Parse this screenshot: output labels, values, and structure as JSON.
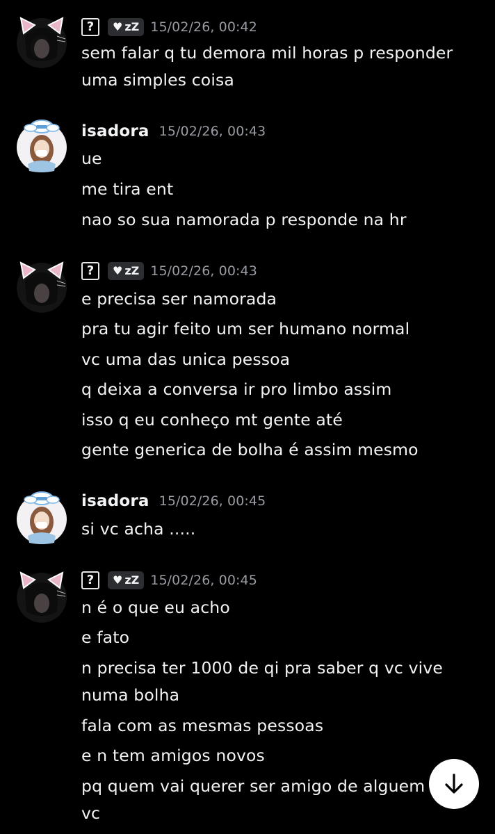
{
  "messages": [
    {
      "author_type": "unknown",
      "author_name": "",
      "status_icons": [
        "heart-icon",
        "sleep-zz-icon"
      ],
      "status_text": "zZ",
      "timestamp": "15/02/26, 00:42",
      "lines": [
        "sem falar q tu demora mil horas p responder",
        "uma simples coisa"
      ]
    },
    {
      "author_type": "named",
      "author_name": "isadora",
      "timestamp": "15/02/26, 00:43",
      "lines": [
        "ue",
        "me tira ent",
        "nao so sua namorada p responde na hr"
      ]
    },
    {
      "author_type": "unknown",
      "author_name": "",
      "status_text": "zZ",
      "timestamp": "15/02/26, 00:43",
      "lines": [
        "e precisa ser namorada",
        "pra tu agir feito um ser humano normal",
        "vc uma das unica pessoa",
        "q deixa a conversa ir pro limbo assim",
        "isso q eu conheço mt gente até",
        "gente generica de bolha é assim mesmo"
      ]
    },
    {
      "author_type": "named",
      "author_name": "isadora",
      "timestamp": "15/02/26, 00:45",
      "lines": [
        "si vc acha ....."
      ]
    },
    {
      "author_type": "unknown",
      "author_name": "",
      "status_text": "zZ",
      "timestamp": "15/02/26, 00:45",
      "lines": [
        "n é o que eu acho",
        "e fato",
        "n precisa ter 1000 de qi pra saber q vc vive",
        "numa bolha",
        "fala com as mesmas pessoas",
        "e n tem amigos novos",
        "pq quem vai querer ser amigo de alguem",
        "vc"
      ]
    }
  ],
  "unknown_user_glyph": "?",
  "scroll_button_icon": "arrow-down-icon",
  "colors": {
    "background": "#000000",
    "text": "#f2f3f5",
    "timestamp": "#9a9ca3",
    "status_tag_bg": "#2b2d31",
    "scroll_button_bg": "#ffffff"
  }
}
